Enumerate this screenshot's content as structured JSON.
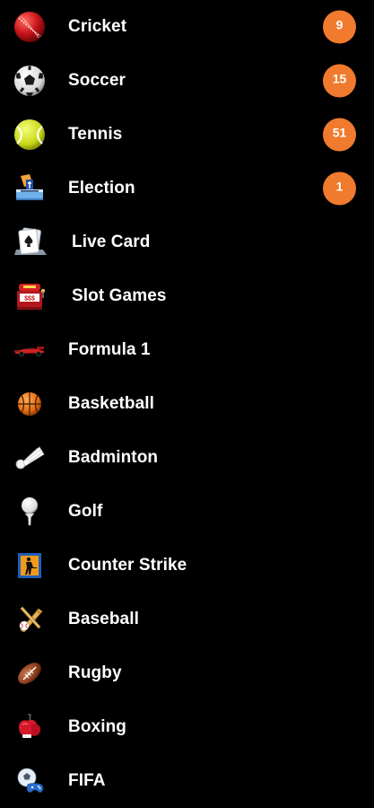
{
  "menu": {
    "items": [
      {
        "label": "Cricket",
        "icon": "cricket-ball-icon",
        "badge": "9"
      },
      {
        "label": "Soccer",
        "icon": "soccer-ball-icon",
        "badge": "15"
      },
      {
        "label": "Tennis",
        "icon": "tennis-ball-icon",
        "badge": "51"
      },
      {
        "label": "Election",
        "icon": "ballot-box-icon",
        "badge": "1"
      },
      {
        "label": "Live Card",
        "icon": "playing-card-icon"
      },
      {
        "label": "Slot Games",
        "icon": "slot-machine-icon"
      },
      {
        "label": "Formula 1",
        "icon": "race-car-icon"
      },
      {
        "label": "Basketball",
        "icon": "basketball-icon"
      },
      {
        "label": "Badminton",
        "icon": "shuttlecock-icon"
      },
      {
        "label": "Golf",
        "icon": "golf-ball-on-tee-icon"
      },
      {
        "label": "Counter Strike",
        "icon": "counter-strike-icon"
      },
      {
        "label": "Baseball",
        "icon": "baseball-bat-icon"
      },
      {
        "label": "Rugby",
        "icon": "rugby-ball-icon"
      },
      {
        "label": "Boxing",
        "icon": "boxing-glove-icon"
      },
      {
        "label": "FIFA",
        "icon": "fifa-controller-icon"
      }
    ]
  },
  "colors": {
    "background": "#000000",
    "text": "#ffffff",
    "badge": "#f07a2d"
  }
}
